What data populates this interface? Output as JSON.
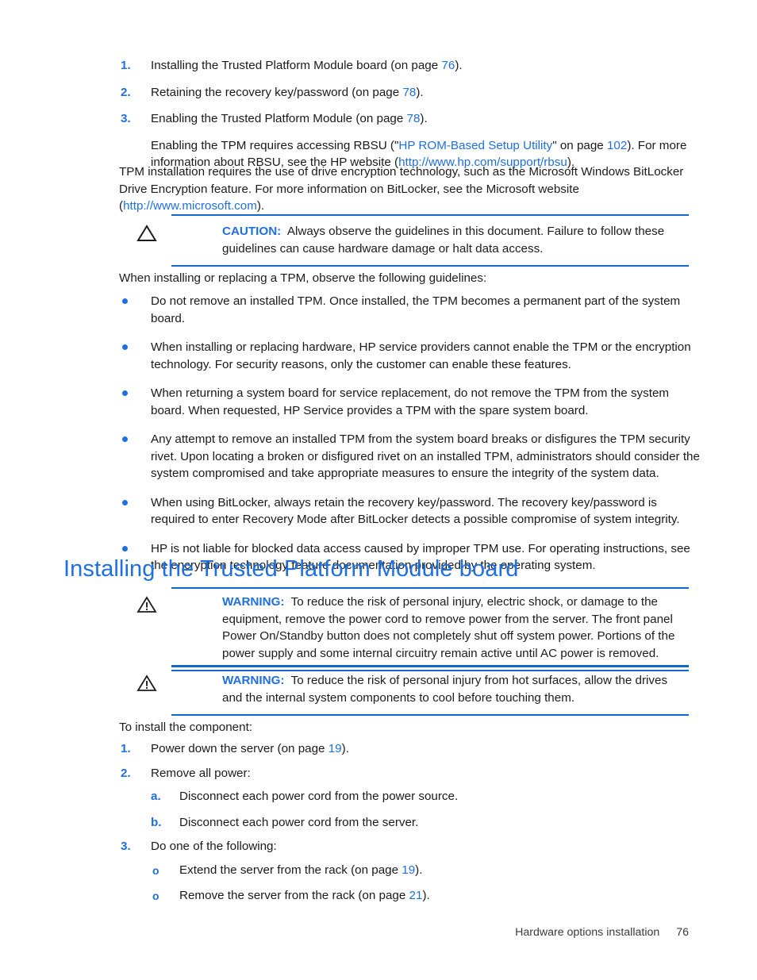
{
  "colors": {
    "accent_blue": "#1f6fe0",
    "rule_blue": "#1267cf",
    "text_black": "#1c1c1c"
  },
  "top_steps": [
    {
      "marker": "1.",
      "text_before": "Installing the Trusted Platform Module board (on page ",
      "page_ref": "76",
      "text_after": ")."
    },
    {
      "marker": "2.",
      "text_before": "Retaining the recovery key/password (on page ",
      "page_ref": "78",
      "text_after": ")."
    },
    {
      "marker": "3.",
      "text_before": "Enabling the Trusted Platform Module (on page ",
      "page_ref": "78",
      "text_after": ")."
    }
  ],
  "rbsu_paragraph": {
    "seg1": "Enabling the TPM requires accessing RBSU (\"",
    "link1": "HP ROM-Based Setup Utility",
    "seg2": "\" on page ",
    "page_ref": "102",
    "seg3": "). For more information about RBSU, see the HP website (",
    "link2": "http://www.hp.com/support/rbsu",
    "seg4": ")."
  },
  "tpm_paragraph": {
    "seg1": "TPM installation requires the use of drive encryption technology, such as the Microsoft Windows BitLocker Drive Encryption feature. For more information on BitLocker, see the Microsoft website (",
    "link1": "http://www.microsoft.com",
    "seg2": ")."
  },
  "caution_box": {
    "icon": "caution-triangle-icon",
    "label": "CAUTION:",
    "text": "Always observe the guidelines in this document. Failure to follow these guidelines can cause hardware damage or halt data access."
  },
  "guidelines_intro": "When installing or replacing a TPM, observe the following guidelines:",
  "guidelines": [
    "Do not remove an installed TPM. Once installed, the TPM becomes a permanent part of the system board.",
    "When installing or replacing hardware, HP service providers cannot enable the TPM or the encryption technology. For security reasons, only the customer can enable these features.",
    "When returning a system board for service replacement, do not remove the TPM from the system board. When requested, HP Service provides a TPM with the spare system board.",
    "Any attempt to remove an installed TPM from the system board breaks or disfigures the TPM security rivet. Upon locating a broken or disfigured rivet on an installed TPM, administrators should consider the system compromised and take appropriate measures to ensure the integrity of the system data.",
    "When using BitLocker, always retain the recovery key/password. The recovery key/password is required to enter Recovery Mode after BitLocker detects a possible compromise of system integrity.",
    "HP is not liable for blocked data access caused by improper TPM use. For operating instructions, see the encryption technology feature documentation provided by the operating system."
  ],
  "section_heading": "Installing the Trusted Platform Module board",
  "warning_boxes": [
    {
      "icon": "warning-triangle-icon",
      "label": "WARNING:",
      "text": "To reduce the risk of personal injury, electric shock, or damage to the equipment, remove the power cord to remove power from the server. The front panel Power On/Standby button does not completely shut off system power. Portions of the power supply and some internal circuitry remain active until AC power is removed."
    },
    {
      "icon": "warning-triangle-icon",
      "label": "WARNING:",
      "text": "To reduce the risk of personal injury from hot surfaces, allow the drives and the internal system components to cool before touching them."
    }
  ],
  "install_intro": "To install the component:",
  "install_steps": [
    {
      "marker": "1.",
      "text_before": "Power down the server (on page ",
      "page_ref": "19",
      "text_after": ")."
    },
    {
      "marker": "2.",
      "text_before": "Remove all power:",
      "page_ref": "",
      "text_after": "",
      "sub_letters": [
        {
          "marker": "a.",
          "text": "Disconnect each power cord from the power source."
        },
        {
          "marker": "b.",
          "text": "Disconnect each power cord from the server."
        }
      ]
    },
    {
      "marker": "3.",
      "text_before": "Do one of the following:",
      "page_ref": "",
      "text_after": "",
      "sub_options": [
        {
          "marker": "o",
          "text_before": "Extend the server from the rack (on page ",
          "page_ref": "19",
          "text_after": ")."
        },
        {
          "marker": "o",
          "text_before": "Remove the server from the rack (on page ",
          "page_ref": "21",
          "text_after": ")."
        }
      ]
    }
  ],
  "footer": {
    "label": "Hardware options installation",
    "page_number": "76"
  }
}
